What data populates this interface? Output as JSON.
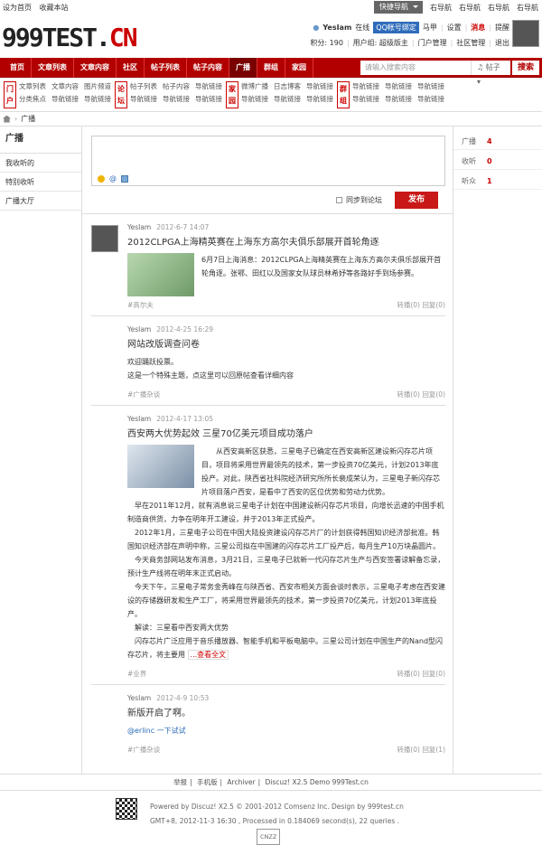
{
  "topbar": {
    "left": [
      "设为首页",
      "收藏本站"
    ],
    "quicknav": "快捷导航",
    "right": [
      "右导航",
      "右导航",
      "右导航",
      "右导航"
    ]
  },
  "logo": {
    "black": "999TEST.",
    "red": "CN"
  },
  "user": {
    "name": "YesIam",
    "status": "在线",
    "qq": "QQ帐号绑定",
    "links": [
      "马甲",
      "设置",
      "消息",
      "提醒"
    ],
    "credit": "积分: 190",
    "group": "用户组: 超级版主",
    "admin": [
      "门户管理",
      "社区管理",
      "退出"
    ]
  },
  "nav": {
    "items": [
      "首页",
      "文章列表",
      "文章内容",
      "社区",
      "帖子列表",
      "帖子内容",
      "广播",
      "群组",
      "家园"
    ],
    "active": 6,
    "search_placeholder": "请输入搜索内容",
    "search_type": "帖子",
    "search_btn": "搜索"
  },
  "subnav": {
    "groups": [
      {
        "label": "门户",
        "links": [
          "文章列表",
          "文章内容",
          "图片频道",
          "分类焦点",
          "导航链接",
          "导航链接"
        ]
      },
      {
        "label": "论坛",
        "links": [
          "帖子列表",
          "帖子内容",
          "导航链接",
          "导航链接",
          "导航链接",
          "导航链接"
        ]
      },
      {
        "label": "家园",
        "links": [
          "微博广播",
          "日志博客",
          "导航链接",
          "导航链接",
          "导航链接",
          "导航链接"
        ]
      },
      {
        "label": "群组",
        "links": [
          "导航链接",
          "导航链接",
          "导航链接",
          "导航链接",
          "导航链接",
          "导航链接"
        ]
      }
    ]
  },
  "breadcrumb": "广播",
  "sidebar": {
    "title": "广播",
    "items": [
      "我收听的",
      "特别收听",
      "广播大厅"
    ],
    "active": 0
  },
  "composer": {
    "sync_label": "同步到论坛",
    "publish": "发布"
  },
  "stats": [
    {
      "label": "广播",
      "value": "4"
    },
    {
      "label": "收听",
      "value": "0"
    },
    {
      "label": "听众",
      "value": "1"
    }
  ],
  "feed": [
    {
      "user": "YesIam",
      "time": "2012-6-7 14:07",
      "title": "2012CLPGA上海精英赛在上海东方高尔夫俱乐部展开首轮角逐",
      "body": [
        "6月7日上海消息：2012CLPGA上海精英赛在上海东方高尔夫俱乐部展开首轮角逐。张鄂、田红以及国家女队球员林希妤等各路好手到场参赛。"
      ],
      "tag": "#高尔夫",
      "forward": "转播(0)",
      "reply": "回复(0)",
      "thumb": true
    },
    {
      "user": "YesIam",
      "time": "2012-4-25 16:29",
      "title": "网站改版调查问卷",
      "body": [
        "欢迎踊跃投票。",
        "这是一个特殊主题，点这里可以回原帖查看详细内容"
      ],
      "tag": "#广播杂谈",
      "forward": "转播(0)",
      "reply": "回复(0)",
      "thumb": false
    },
    {
      "user": "YesIam",
      "time": "2012-4-17 13:05",
      "title": "西安两大优势起效 三星70亿美元项目成功落户",
      "body": [
        "从西安高新区获悉，三星电子已确定在西安高新区建设新闪存芯片项目，项目将采用世界最领先的技术，第一步投资70亿美元，计划2013年底投产。对此，陕西省社科院经济研究所所长裴成荣认为，三星电子新闪存芯片项目落户西安，是看中了西安的区位优势和劳动力优势。",
        "早在2011年12月，就有消息说三星电子计划在中国建设新闪存芯片项目，向增长迅速的中国手机制造商供货，力争在明年开工建设，并于2013年正式投产。",
        "2012年1月，三星电子公司在中国大陆投资建设闪存芯片厂的计划获得韩国知识经济部批准。韩国知识经济部在声明中称，三星公司拟在中国建的闪存芯片工厂投产后，每月生产10万块晶圆片。",
        "今天商务部网站发布消息，3月21日，三星电子已就新一代闪存芯片生产与西安签署谅解备忘录，预计生产线将在明年末正式启动。",
        "今天下午，三星电子常务金秀峰在与陕西省、西安市相关方面会谈时表示，三星电子考虑在西安建设的存储器研发和生产工厂，将采用世界最领先的技术，第一步投资70亿美元，计划2013年底投产。",
        "解读：三星看中西安两大优势",
        "闪存芯片广泛应用于音乐播放器、智能手机和平板电脑中。三星公司计划在中国生产的Nand型闪存芯片，将主要用"
      ],
      "more": "...查看全文",
      "tag": "#业界",
      "forward": "转播(0)",
      "reply": "回复(0)",
      "thumb": true
    },
    {
      "user": "YesIam",
      "time": "2012-4-9 10:53",
      "title": "新版开启了啊。",
      "body": [
        "@erlinc 一下试试"
      ],
      "tag": "#广播杂谈",
      "forward": "转播(0)",
      "reply": "回复(1)",
      "thumb": false
    }
  ],
  "footer": {
    "links": [
      "举报",
      "手机版",
      "Archiver",
      "Discuz! X2.5 Demo 999Test.cn"
    ],
    "powered": "Powered by Discuz! X2.5 © 2001-2012 Comsenz Inc. Design by 999test.cn",
    "info": "GMT+8, 2012-11-3 16:30 , Processed in 0.184069 second(s), 22 queries .",
    "badge": "CNZZ"
  }
}
